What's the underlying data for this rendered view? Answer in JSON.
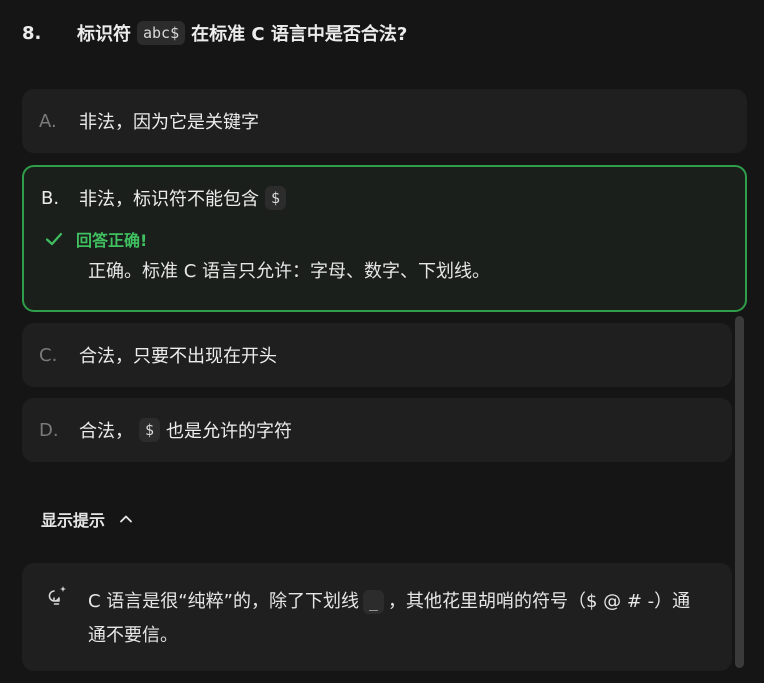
{
  "question": {
    "number": "8.",
    "text_before": "标识符",
    "code": "abc$",
    "text_after": "在标准 C 语言中是否合法?"
  },
  "options": [
    {
      "letter": "A.",
      "text": "非法，因为它是关键字"
    },
    {
      "letter": "B.",
      "text": "非法，标识符不能包含",
      "code": "$"
    },
    {
      "letter": "C.",
      "text": "合法，只要不出现在开头"
    },
    {
      "letter": "D.",
      "text_before": "合法，",
      "code": "$",
      "text_after": "也是允许的字符"
    }
  ],
  "feedback": {
    "label": "回答正确!",
    "explanation": "正确。标准 C 语言只允许：字母、数字、下划线。"
  },
  "hint": {
    "toggle_label": "显示提示",
    "text_before": "C 语言是很“纯粹”的，除了下划线",
    "code": "_",
    "text_after": "，其他花里胡哨的符号（$ @ # -）通通不要信。"
  },
  "colors": {
    "background": "#151515",
    "card": "#1f1f1f",
    "correct_green": "#3fbf5f",
    "correct_border": "#2f9e4a"
  }
}
